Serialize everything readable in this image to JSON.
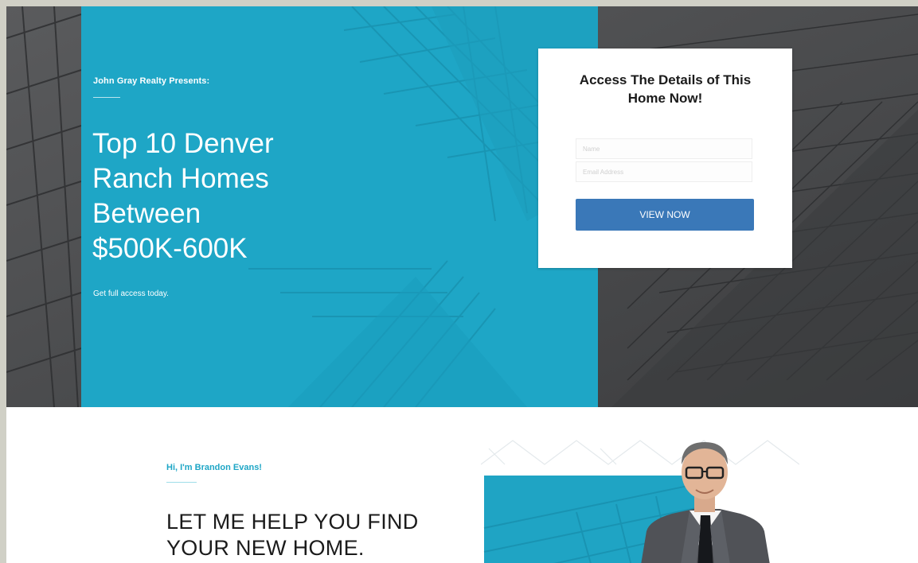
{
  "hero": {
    "eyebrow": "John Gray Realty Presents:",
    "headline_lines": [
      "Top 10 Denver",
      "Ranch Homes",
      "Between",
      "$500K-600K"
    ],
    "subtext": "Get full access today."
  },
  "form": {
    "title_lines": [
      "Access The Details of This",
      "Home Now!"
    ],
    "name_placeholder": "Name",
    "email_placeholder": "Email Address",
    "cta_label": "VIEW NOW"
  },
  "about": {
    "eyebrow": "Hi, I'm Brandon Evans!",
    "heading_lines": [
      "LET ME HELP YOU FIND",
      "YOUR NEW HOME."
    ]
  },
  "colors": {
    "accent": "#1ea6c6",
    "button": "#3a78b8",
    "dark_bg": "#4a4b4d",
    "page_frame": "#d0d0c6"
  }
}
